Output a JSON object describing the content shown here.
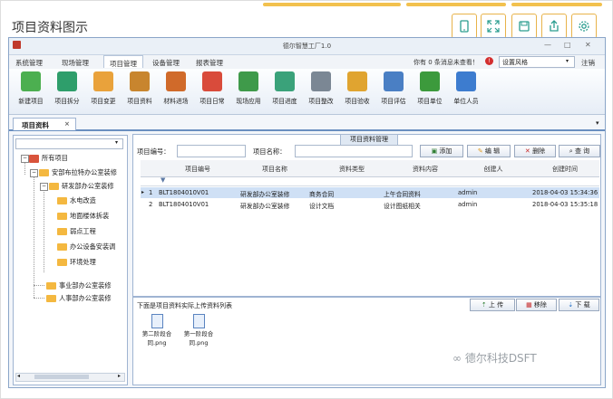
{
  "page_title": "项目资料图示",
  "app": {
    "window_title": "德尔智慧工厂1.0",
    "menus": [
      "系统管理",
      "现场管理",
      "项目管理",
      "设备管理",
      "报表管理"
    ],
    "active_menu": "项目管理",
    "message": "你有 0 条消息未查看！",
    "style_select": "设置风格",
    "logout": "注销"
  },
  "ribbon": [
    {
      "label": "新建项目",
      "icon": "new-project-icon",
      "color": "#4caf50"
    },
    {
      "label": "项目拆分",
      "icon": "split-project-icon",
      "color": "#2e9e6b"
    },
    {
      "label": "项目变更",
      "icon": "change-project-icon",
      "color": "#e9a23b"
    },
    {
      "label": "项目资料",
      "icon": "project-docs-icon",
      "color": "#c8852e"
    },
    {
      "label": "材料进场",
      "icon": "material-truck-icon",
      "color": "#d06a2a"
    },
    {
      "label": "项目日常",
      "icon": "calendar-icon",
      "color": "#d94b3b"
    },
    {
      "label": "现场应用",
      "icon": "map-icon",
      "color": "#3f9a4a"
    },
    {
      "label": "项目进度",
      "icon": "progress-icon",
      "color": "#3aa27a"
    },
    {
      "label": "项目整改",
      "icon": "tools-icon",
      "color": "#7b8794"
    },
    {
      "label": "项目验收",
      "icon": "accept-icon",
      "color": "#e0a430"
    },
    {
      "label": "项目评估",
      "icon": "thumb-up-icon",
      "color": "#4a7fc4"
    },
    {
      "label": "项目单位",
      "icon": "unit-icon",
      "color": "#3c9a3c"
    },
    {
      "label": "单位人员",
      "icon": "people-icon",
      "color": "#3d7ccf"
    }
  ],
  "doc_tab": "项目资料",
  "tree": {
    "root": "所有项目",
    "level1": "安部布拉特办公室装修",
    "level2": "研发部办公室装修",
    "children": [
      "水电改造",
      "地面楼体拆装",
      "弱点工程",
      "办公设备安装调",
      "环境处理"
    ],
    "siblings": [
      "事业部办公室装修",
      "人事部办公室装修"
    ]
  },
  "query": {
    "group_caption": "项目资料管理",
    "code_label": "项目编号：",
    "name_label": "项目名称：",
    "add": "添加",
    "edit": "编 辑",
    "delete": "删除",
    "search": "查 询"
  },
  "table": {
    "columns": [
      "项目编号",
      "项目名称",
      "资料类型",
      "资料内容",
      "创建人",
      "创建时间"
    ],
    "rows": [
      {
        "idx": "1",
        "code": "BLT1804010V01",
        "name": "研发部办公室装修",
        "type": "商务合同",
        "content": "上午合同资料",
        "creator": "admin",
        "time": "2018-04-03 15:34:36"
      },
      {
        "idx": "2",
        "code": "BLT1804010V01",
        "name": "研发部办公室装修",
        "type": "设计文档",
        "content": "设计图纸相关",
        "creator": "admin",
        "time": "2018-04-03 15:35:18"
      }
    ]
  },
  "files": {
    "caption": "下面是项目资料实际上传资料列表",
    "upload": "上 传",
    "remove": "移除",
    "download": "下 载",
    "items": [
      {
        "line1": "第二阶段合",
        "line2": "同.png"
      },
      {
        "line1": "第一阶段合",
        "line2": "同.png"
      }
    ]
  },
  "watermark": "德尔科技DSFT",
  "colors": {
    "accent": "#f2c14e",
    "window_border": "#8aa5c8",
    "selected_row": "#cfe0f5"
  }
}
